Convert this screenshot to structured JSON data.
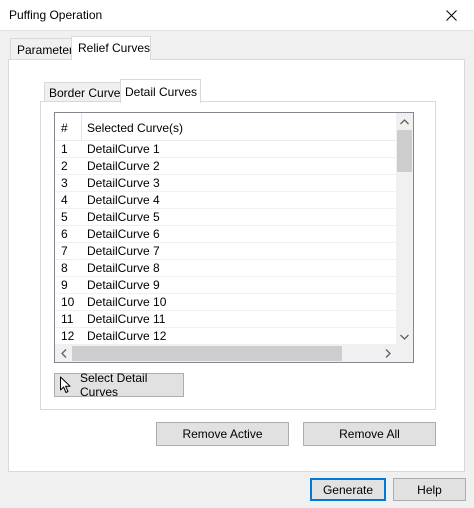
{
  "window": {
    "title": "Puffing Operation"
  },
  "outer_tabs": [
    {
      "label": "Parameters"
    },
    {
      "label": "Relief Curves"
    }
  ],
  "inner_tabs": [
    {
      "label": "Border Curves"
    },
    {
      "label": "Detail Curves"
    }
  ],
  "list": {
    "headers": {
      "num": "#",
      "curve": "Selected Curve(s)"
    },
    "rows": [
      {
        "num": "1",
        "name": "DetailCurve 1"
      },
      {
        "num": "2",
        "name": "DetailCurve 2"
      },
      {
        "num": "3",
        "name": "DetailCurve 3"
      },
      {
        "num": "4",
        "name": "DetailCurve 4"
      },
      {
        "num": "5",
        "name": "DetailCurve 5"
      },
      {
        "num": "6",
        "name": "DetailCurve 6"
      },
      {
        "num": "7",
        "name": "DetailCurve 7"
      },
      {
        "num": "8",
        "name": "DetailCurve 8"
      },
      {
        "num": "9",
        "name": "DetailCurve 9"
      },
      {
        "num": "10",
        "name": "DetailCurve 10"
      },
      {
        "num": "11",
        "name": "DetailCurve 11"
      },
      {
        "num": "12",
        "name": "DetailCurve 12"
      }
    ]
  },
  "buttons": {
    "select_detail": "Select Detail Curves",
    "remove_active": "Remove Active",
    "remove_all": "Remove All",
    "generate": "Generate",
    "help": "Help"
  },
  "icons": {
    "close": "close-icon",
    "select": "cursor-arrow-icon",
    "scroll_up": "chevron-up-icon",
    "scroll_down": "chevron-down-icon",
    "scroll_left": "chevron-left-icon",
    "scroll_right": "chevron-right-icon"
  },
  "colors": {
    "primary_border": "#0078d7",
    "button_bg": "#e1e1e1"
  }
}
